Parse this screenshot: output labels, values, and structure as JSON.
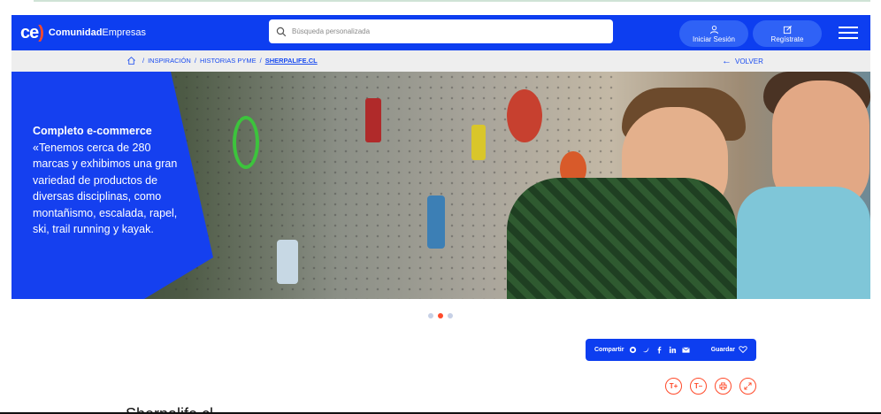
{
  "header": {
    "logo_mark": "ce",
    "logo_paren": ")",
    "logo_bold": "Comunidad",
    "logo_regular": "Empresas",
    "search_placeholder": "Búsqueda personalizada",
    "login_label": "Iniciar Sesión",
    "register_label": "Regístrate"
  },
  "breadcrumb": {
    "items": [
      "INSPIRACIÓN",
      "HISTORIAS PYME",
      "SHERPALIFE.CL"
    ],
    "back_label": "VOLVER"
  },
  "hero": {
    "heading": "Completo e-commerce",
    "body": "«Tenemos cerca de 280 marcas y exhibimos una gran variedad de productos de diversas disciplinas, como montañismo, escalada, rapel, ski, trail running y kayak."
  },
  "carousel": {
    "total": 3,
    "active": 2
  },
  "share": {
    "label": "Compartir",
    "save_label": "Guardar"
  },
  "tools": {
    "increase": "T+",
    "decrease": "T–"
  },
  "article": {
    "title_fragment": "Sherpalife.cl"
  },
  "colors": {
    "brand": "#0d3ef0",
    "accent": "#ff4a2a"
  }
}
